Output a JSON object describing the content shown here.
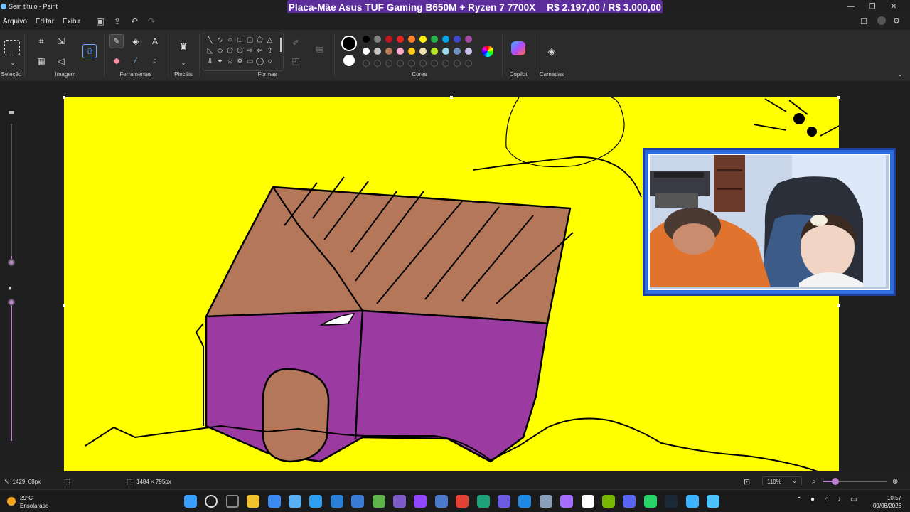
{
  "window": {
    "title": "Sem título - Paint"
  },
  "banner": {
    "product": "Placa-Mãe Asus TUF Gaming B650M + Ryzen 7 7700X",
    "price": "R$ 2.197,00 / R$ 3.000,00"
  },
  "menu": [
    "Arquivo",
    "Editar",
    "Exibir"
  ],
  "ribbon": {
    "groups": {
      "selection": "Seleção",
      "image": "Imagem",
      "tools": "Ferramentas",
      "brushes": "Pincéis",
      "shapes": "Formas",
      "colors": "Cores",
      "copilot": "Copilot",
      "layers": "Camadas"
    },
    "palette_row1": [
      "#000000",
      "#7f7f7f",
      "#c4141d",
      "#e8231f",
      "#ff7f27",
      "#fff200",
      "#22b14c",
      "#00a2e8",
      "#3f48cc",
      "#a349a4"
    ],
    "palette_row2": [
      "#ffffff",
      "#c3c3c3",
      "#b97a57",
      "#ffaec9",
      "#ffc90e",
      "#efe4b0",
      "#b5e61d",
      "#99d9ea",
      "#7092be",
      "#c8bfe7"
    ],
    "primary_color": "#000000",
    "secondary_color": "#ffffff"
  },
  "canvas": {
    "background": "#ffff00"
  },
  "status": {
    "cursor_pos": "1429, 68px",
    "canvas_size": "1484 × 795px",
    "zoom": "110%"
  },
  "taskbar": {
    "weather_temp": "29°C",
    "weather_desc": "Ensolarado",
    "time": "10:57",
    "date": "09/08/2026",
    "icons": [
      "start-icon",
      "search-icon",
      "task-view-icon",
      "file-explorer-icon",
      "store-icon",
      "notepad-icon",
      "feather-icon",
      "vscode-icon",
      "azure-icon",
      "minecraft-icon",
      "hoyo-icon",
      "twitch-icon",
      "monitor-icon",
      "chrome-icon",
      "edge-icon",
      "loop-icon",
      "outlook-icon",
      "settings-icon",
      "copilot-icon",
      "capcut-icon",
      "nvidia-icon",
      "discord-icon",
      "whatsapp-icon",
      "steam-icon",
      "notes-icon",
      "paint-icon"
    ]
  }
}
